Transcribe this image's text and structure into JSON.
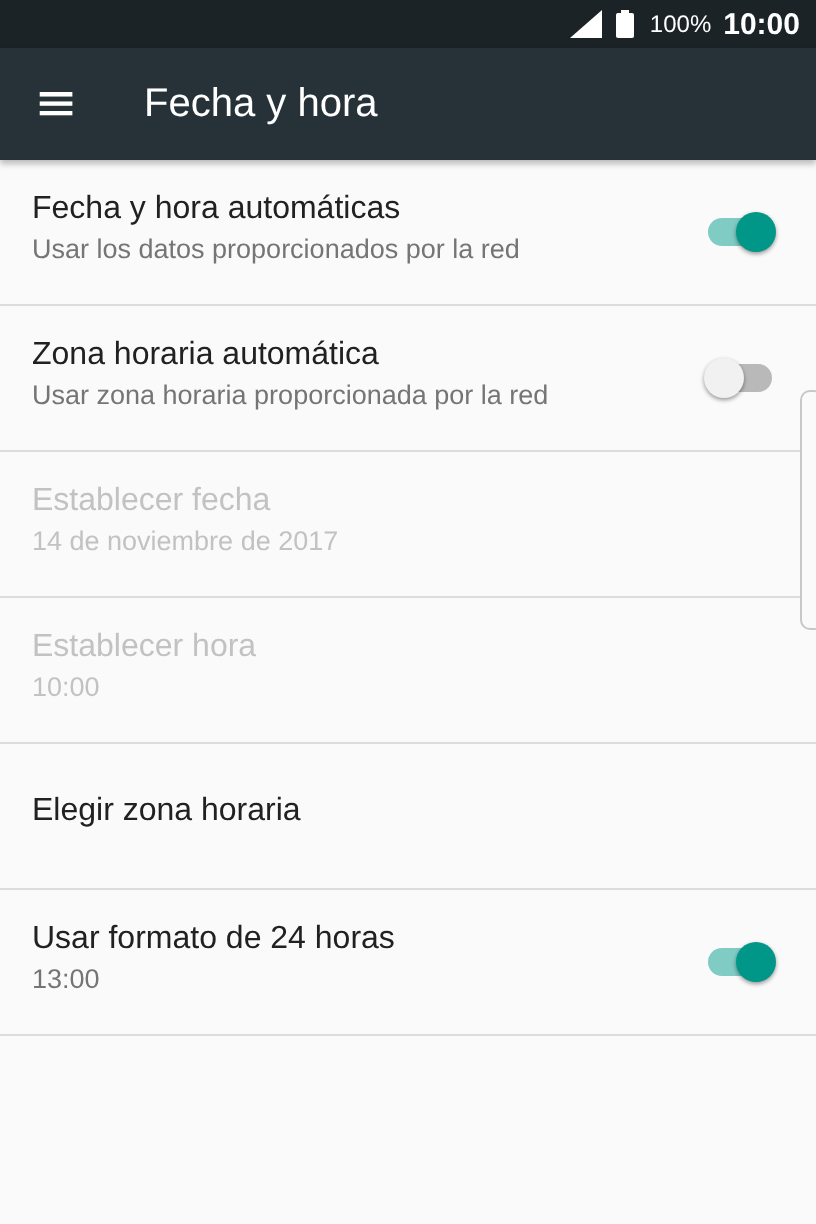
{
  "status_bar": {
    "battery": "100%",
    "time": "10:00"
  },
  "toolbar": {
    "menu_icon": "≡",
    "title": "Fecha y hora"
  },
  "settings": [
    {
      "kind": "switch",
      "title": "Fecha y hora automáticas",
      "summary": "Usar los datos proporcionados por la red",
      "disabled": false,
      "on": true
    },
    {
      "kind": "switch",
      "title": "Zona horaria automática",
      "summary": "Usar zona horaria proporcionada por la red",
      "disabled": false,
      "on": false
    },
    {
      "kind": "text",
      "title": "Establecer fecha",
      "summary": "14 de noviembre de 2017",
      "disabled": true
    },
    {
      "kind": "text",
      "title": "Establecer hora",
      "summary": "10:00",
      "disabled": true
    },
    {
      "kind": "text",
      "title": "Elegir zona horaria",
      "disabled": false
    },
    {
      "kind": "switch",
      "title": "Usar formato de 24 horas",
      "summary": "13:00",
      "disabled": false,
      "on": true
    }
  ]
}
